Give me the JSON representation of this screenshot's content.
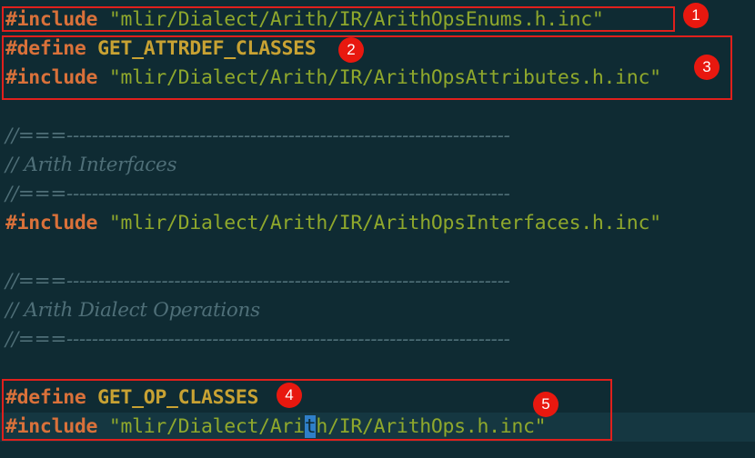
{
  "code": {
    "line1": {
      "kw": "#include",
      "str": "\"mlir/Dialect/Arith/IR/ArithOpsEnums.h.inc\""
    },
    "line2": {
      "kw": "#define",
      "macro": "GET_ATTRDEF_CLASSES"
    },
    "line3": {
      "kw": "#include",
      "str": "\"mlir/Dialect/Arith/IR/ArithOpsAttributes.h.inc\""
    },
    "line5": "//===----------------------------------------------------------------------",
    "line6": "// Arith Interfaces",
    "line7": "//===----------------------------------------------------------------------",
    "line8": {
      "kw": "#include",
      "str": "\"mlir/Dialect/Arith/IR/ArithOpsInterfaces.h.inc\""
    },
    "line10": "//===----------------------------------------------------------------------",
    "line11": "// Arith Dialect Operations",
    "line12": "//===----------------------------------------------------------------------",
    "line14": {
      "kw": "#define",
      "macro": "GET_OP_CLASSES"
    },
    "line15": {
      "kw": "#include",
      "str_before": "\"mlir/Dialect/Ari",
      "cursor": "t",
      "str_after": "h/IR/ArithOps.h.inc\""
    }
  },
  "annotations": [
    "1",
    "2",
    "3",
    "4",
    "5"
  ],
  "colors": {
    "background": "#0f2b33",
    "keyword": "#d9713a",
    "macro": "#c8a233",
    "string": "#8fa82c",
    "comment": "#4f6f78",
    "annotation": "#e0201c"
  }
}
